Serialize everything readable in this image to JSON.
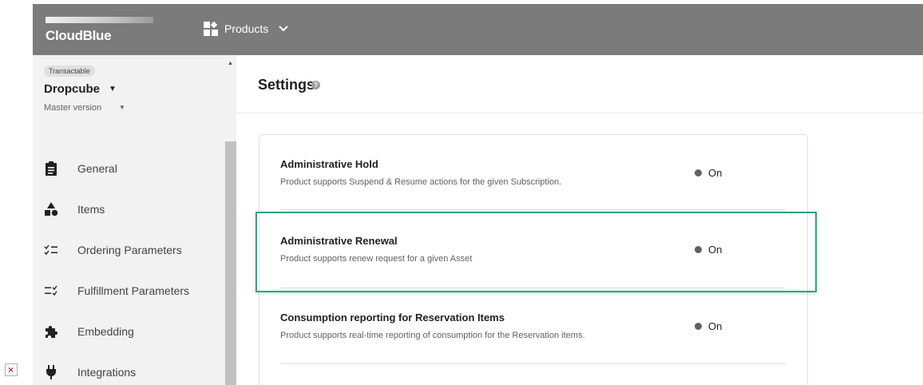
{
  "topbar": {
    "logo": "CloudBlue",
    "products_label": "Products",
    "products_icon": "grid-icon",
    "chevron_icon": "chevron-down-icon"
  },
  "product": {
    "badge": "Transactable",
    "name": "Dropcube",
    "version": "Master version"
  },
  "nav": {
    "items": [
      {
        "label": "General",
        "icon": "clipboard-icon"
      },
      {
        "label": "Items",
        "icon": "shapes-icon"
      },
      {
        "label": "Ordering Parameters",
        "icon": "checklist-icon"
      },
      {
        "label": "Fulfillment Parameters",
        "icon": "checklist-reverse-icon"
      },
      {
        "label": "Embedding",
        "icon": "puzzle-icon"
      },
      {
        "label": "Integrations",
        "icon": "plug-icon"
      }
    ]
  },
  "main": {
    "title": "Settings",
    "settings": [
      {
        "title": "Administrative Hold",
        "description": "Product supports Suspend & Resume actions for the given Subscription.",
        "status": "On"
      },
      {
        "title": "Administrative Renewal",
        "description": "Product supports renew request for a given Asset",
        "status": "On"
      },
      {
        "title": "Consumption reporting for Reservation Items",
        "description": "Product supports real-time reporting of consumption for the Reservation items.",
        "status": "On"
      }
    ]
  },
  "colors": {
    "topbar": "#7b7b7b",
    "highlight": "#2aa58e",
    "sidebar": "#f2f2f2"
  }
}
